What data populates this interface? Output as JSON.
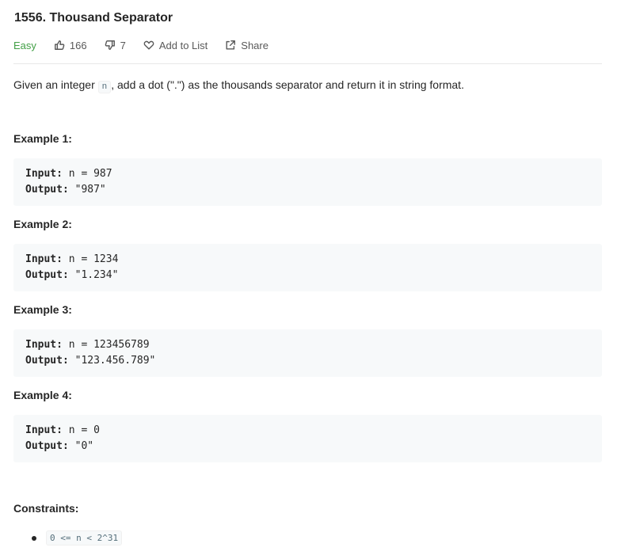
{
  "problem": {
    "title": "1556. Thousand Separator",
    "difficulty": "Easy",
    "likes": "166",
    "dislikes": "7",
    "add_to_list_label": "Add to List",
    "share_label": "Share"
  },
  "description": {
    "before": "Given an integer ",
    "code": "n",
    "after": ", add a dot (\".\") as the thousands separator and return it in string format."
  },
  "examples": [
    {
      "title": "Example 1:",
      "input_label": "Input:",
      "input": " n = 987",
      "output_label": "Output:",
      "output": " \"987\""
    },
    {
      "title": "Example 2:",
      "input_label": "Input:",
      "input": " n = 1234",
      "output_label": "Output:",
      "output": " \"1.234\""
    },
    {
      "title": "Example 3:",
      "input_label": "Input:",
      "input": " n = 123456789",
      "output_label": "Output:",
      "output": " \"123.456.789\""
    },
    {
      "title": "Example 4:",
      "input_label": "Input:",
      "input": " n = 0",
      "output_label": "Output:",
      "output": " \"0\""
    }
  ],
  "constraints": {
    "title": "Constraints:",
    "items": [
      "0 <= n < 2^31"
    ]
  },
  "icons": {
    "like": "thumbs-up-icon",
    "dislike": "thumbs-down-icon",
    "favorite": "heart-icon",
    "share": "share-icon"
  },
  "colors": {
    "easy": "#43a047",
    "code_bg": "#f7f9fa",
    "text": "#262626",
    "muted": "#595959"
  }
}
